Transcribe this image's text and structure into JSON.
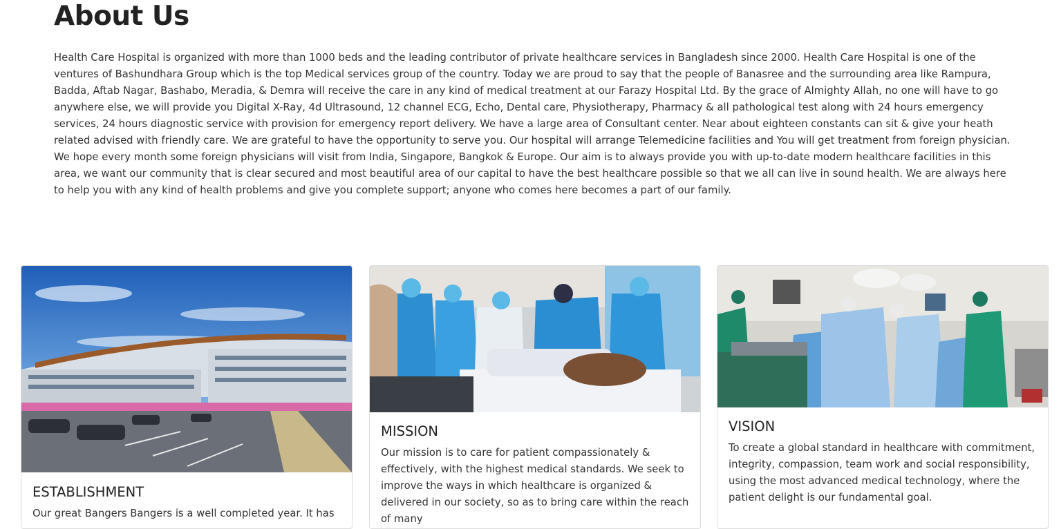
{
  "about": {
    "title": "About Us",
    "paragraph": "Health Care Hospital is organized with more than 1000 beds and the leading contributor of private healthcare services in Bangladesh since 2000. Health Care Hospital is one of the ventures of Bashundhara Group which is the top Medical services group of the country. Today we are proud to say that the people of Banasree and the surrounding area like Rampura, Badda, Aftab Nagar, Bashabo, Meradia, & Demra will receive the care in any kind of medical treatment at our Farazy Hospital Ltd. By the grace of Almighty Allah, no one will have to go anywhere else, we will provide you Digital X-Ray, 4d Ultrasound, 12 channel ECG, Echo, Dental care, Physiotherapy, Pharmacy & all pathological test along with 24 hours emergency services, 24 hours diagnostic service with provision for emergency report delivery. We have a large area of Consultant center. Near about eighteen constants can sit & give your heath related advised with friendly care. We are grateful to have the opportunity to serve you. Our hospital will arrange Telemedicine facilities and You will get treatment from foreign physician. We hope every month some foreign physicians will visit from India, Singapore, Bangkok & Europe. Our aim is to always provide you with up-to-date modern healthcare facilities in this area, we want our community that is clear secured and most beautiful area of our capital to have the best healthcare possible so that we all can live in sound health. We are always here to help you with any kind of health problems and give you complete support; anyone who comes here becomes a part of our family."
  },
  "cards": [
    {
      "title": "ESTABLISHMENT",
      "text": "Our great Bangers Bangers is a well completed year. It has"
    },
    {
      "title": "MISSION",
      "text": "Our mission is to care for patient compassionately & effectively, with the highest medical standards. We seek to improve the ways in which healthcare is organized & delivered in our society, so as to bring care within the reach of many"
    },
    {
      "title": "VISION",
      "text": "To create a global standard in healthcare with commitment, integrity, compassion, team work and social responsibility, using the most advanced medical technology, where the patient delight is our fundamental goal."
    }
  ]
}
